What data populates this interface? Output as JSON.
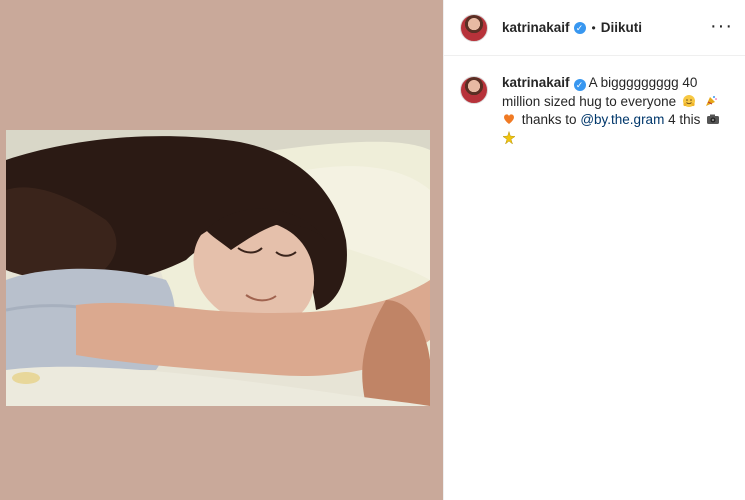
{
  "header": {
    "username": "katrinakaif",
    "separator": "•",
    "follow_label": "Diikuti",
    "more_icon": "more-horizontal-icon"
  },
  "caption": {
    "username": "katrinakaif",
    "text_1": "A biggggggggg 40 million sized hug to everyone",
    "text_2": "thanks to",
    "mention": "@by.the.gram",
    "text_3": "4 this",
    "emojis": [
      "hugging-face-emoji",
      "party-popper-emoji",
      "orange-heart-emoji",
      "camera-emoji",
      "sparkle-emoji"
    ]
  },
  "colors": {
    "media_background": "#c9a99a",
    "verified_badge": "#3897f0",
    "mention": "#00376b"
  }
}
